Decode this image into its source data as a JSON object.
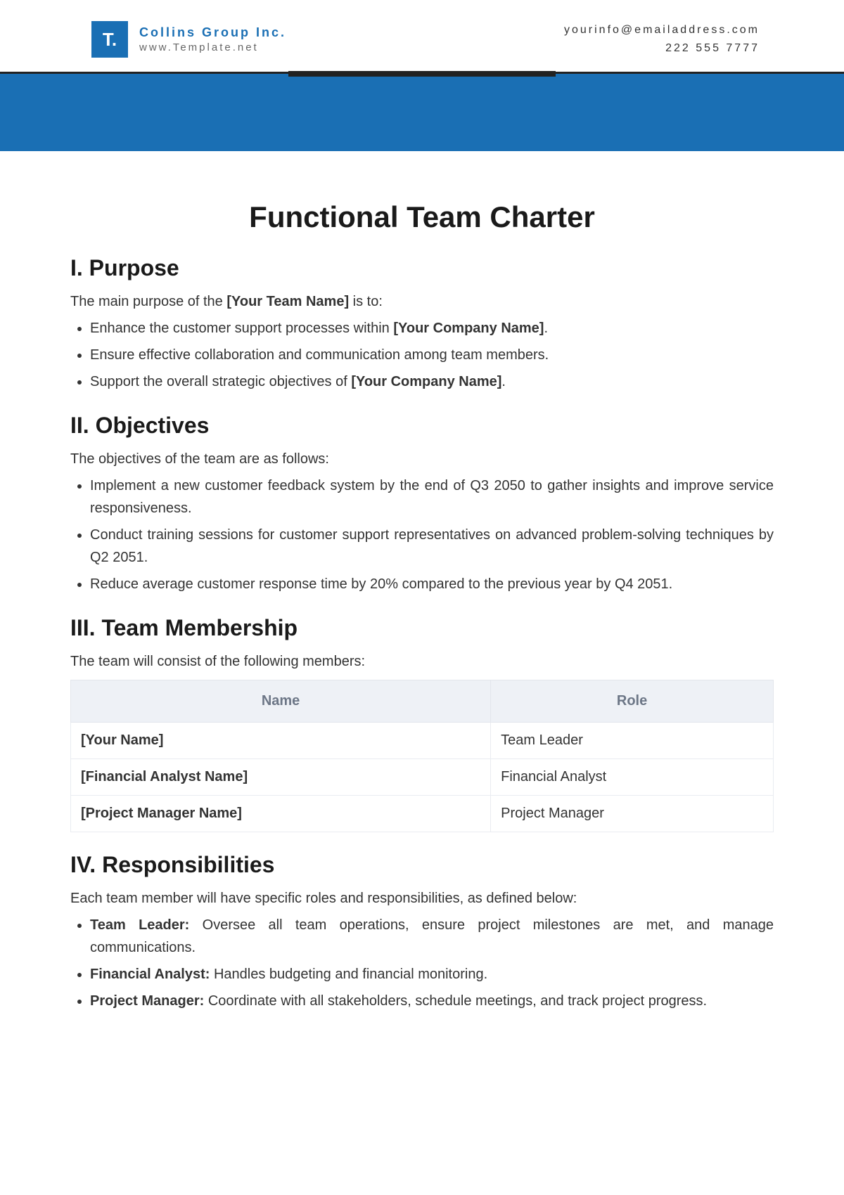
{
  "header": {
    "logo_letter": "T.",
    "company_name": "Collins Group Inc.",
    "company_url": "www.Template.net",
    "email": "yourinfo@emailaddress.com",
    "phone": "222 555 7777"
  },
  "doc": {
    "title": "Functional Team Charter",
    "sections": {
      "purpose": {
        "heading": "I. Purpose",
        "intro_prefix": "The main purpose of the ",
        "intro_placeholder": "[Your Team Name]",
        "intro_suffix": " is to:",
        "items": [
          {
            "pre": "Enhance the customer support processes within ",
            "bold": "[Your Company Name]",
            "post": "."
          },
          {
            "pre": "Ensure effective collaboration and communication among team members.",
            "bold": "",
            "post": ""
          },
          {
            "pre": "Support the overall strategic objectives of ",
            "bold": "[Your Company Name]",
            "post": "."
          }
        ]
      },
      "objectives": {
        "heading": "II. Objectives",
        "intro": "The objectives of the team are as follows:",
        "items": [
          "Implement a new customer feedback system by the end of Q3 2050 to gather insights and improve service responsiveness.",
          "Conduct training sessions for customer support representatives on advanced problem-solving techniques by Q2 2051.",
          "Reduce average customer response time by 20% compared to the previous year by Q4 2051."
        ]
      },
      "membership": {
        "heading": "III. Team Membership",
        "intro": "The team will consist of the following members:",
        "columns": [
          "Name",
          "Role"
        ],
        "rows": [
          {
            "name": "[Your Name]",
            "role": "Team Leader"
          },
          {
            "name": "[Financial Analyst Name]",
            "role": "Financial Analyst"
          },
          {
            "name": "[Project Manager Name]",
            "role": "Project Manager"
          }
        ]
      },
      "responsibilities": {
        "heading": "IV. Responsibilities",
        "intro": "Each team member will have specific roles and responsibilities, as defined below:",
        "items": [
          {
            "role": "Team Leader:",
            "desc": " Oversee all team operations, ensure project milestones are met, and manage communications."
          },
          {
            "role": "Financial Analyst:",
            "desc": " Handles budgeting and financial monitoring."
          },
          {
            "role": "Project Manager:",
            "desc": " Coordinate with all stakeholders, schedule meetings, and track project progress."
          }
        ]
      }
    }
  }
}
